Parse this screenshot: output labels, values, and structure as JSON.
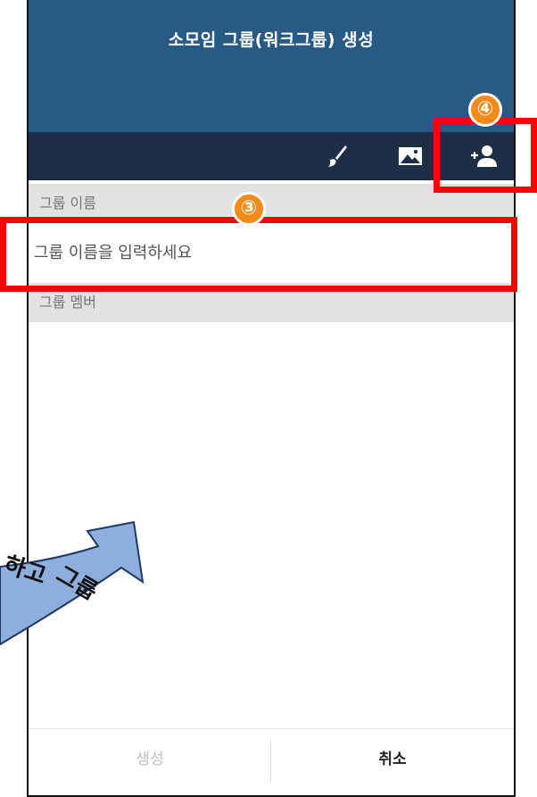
{
  "header": {
    "title": "소모임 그룹(워크그룹) 생성"
  },
  "toolbar": {
    "icons": [
      "paintbrush-icon",
      "image-icon",
      "add-person-icon"
    ]
  },
  "form": {
    "group_name_label": "그룹 이름",
    "group_name_placeholder": "그룹 이름을 입력하세요",
    "group_member_label": "그룹 멤버"
  },
  "footer": {
    "create_label": "생성",
    "cancel_label": "취소"
  },
  "annotations": {
    "step3": "③",
    "step4": "④",
    "arrow_text_1": "하고",
    "arrow_text_2": "그룹"
  },
  "colors": {
    "header": "#285a86",
    "toolbar": "#1c2f46",
    "highlight": "#ff0000",
    "badge": "#f48a1a",
    "arrow": "#8eaedd"
  }
}
